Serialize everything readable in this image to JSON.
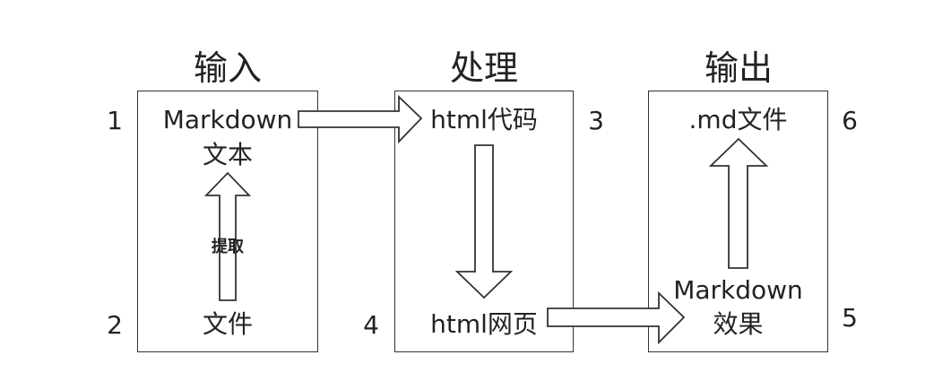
{
  "stages": {
    "input": {
      "heading": "输入"
    },
    "process": {
      "heading": "处理"
    },
    "output": {
      "heading": "输出"
    }
  },
  "nodes": {
    "markdown_text": {
      "line1": "Markdown",
      "line2": "文本",
      "number": "1"
    },
    "file": {
      "label": "文件",
      "number": "2"
    },
    "html_code": {
      "label": "html代码",
      "number": "3"
    },
    "html_page": {
      "label": "html网页",
      "number": "4"
    },
    "markdown_effect": {
      "line1": "Markdown",
      "line2": "效果",
      "number": "5"
    },
    "md_file": {
      "label": ".md文件",
      "number": "6"
    }
  },
  "edges": {
    "extract": {
      "label": "提取"
    }
  }
}
